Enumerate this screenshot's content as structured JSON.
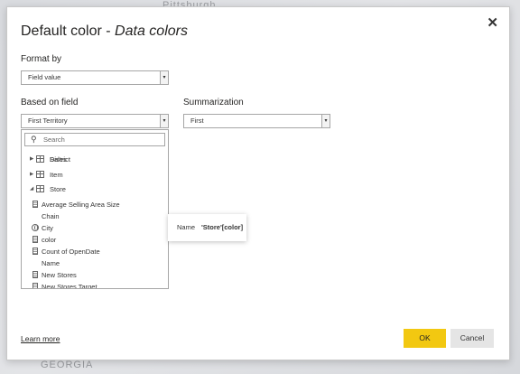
{
  "background": {
    "top_label": "Pittsburgh",
    "bottom_label": "GEORGIA"
  },
  "dialog": {
    "title_main": "Default color - ",
    "title_italic": "Data colors",
    "close_icon": "✕"
  },
  "format_by": {
    "label": "Format by",
    "value": "Field value"
  },
  "based_on_field": {
    "label": "Based on field",
    "value": "First Territory"
  },
  "summarization": {
    "label": "Summarization",
    "value": "First"
  },
  "caret_icon": "▾",
  "field_list": {
    "search_placeholder": "Search",
    "items": [
      {
        "label": "Sales",
        "expander": "▶"
      },
      {
        "label": "District",
        "expander": "▶"
      },
      {
        "label": "Item",
        "expander": "▶"
      },
      {
        "label": "Store",
        "expander": "◢"
      },
      {
        "label": "Average Selling Area Size"
      },
      {
        "label": "Chain"
      },
      {
        "label": "City"
      },
      {
        "label": "color"
      },
      {
        "label": "Count of OpenDate"
      },
      {
        "label": "Name"
      },
      {
        "label": "New Stores"
      },
      {
        "label": "New Stores Target"
      }
    ]
  },
  "tooltip": {
    "key": "Name",
    "value": "'Store'[color]"
  },
  "footer": {
    "learn_more": "Learn more",
    "ok": "OK",
    "cancel": "Cancel"
  }
}
